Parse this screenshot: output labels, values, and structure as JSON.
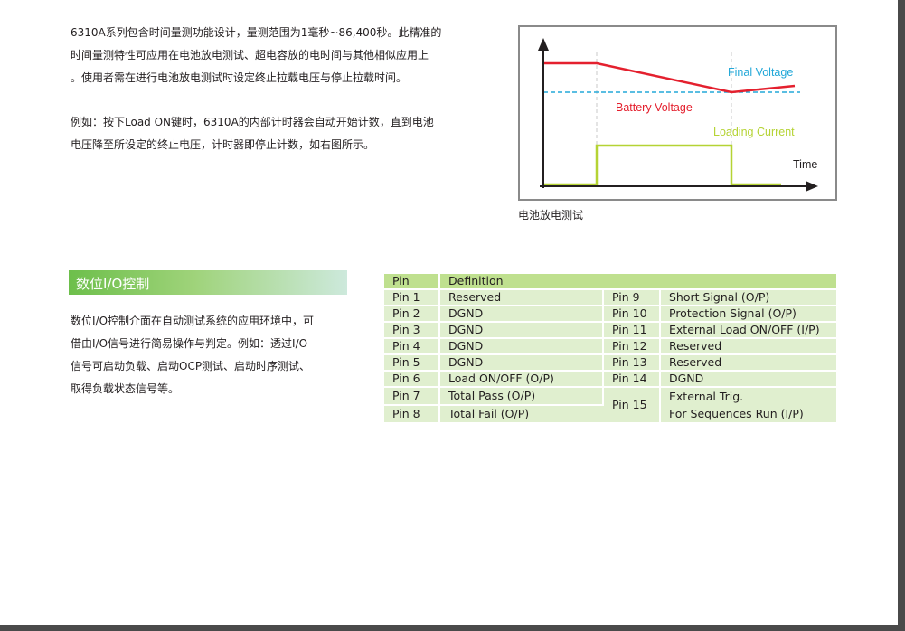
{
  "intro": {
    "lines": [
      "6310A系列包含时间量测功能设计，量测范围为1毫秒~86,400秒。此精准的",
      "时间量测特性可应用在电池放电测试、超电容放的电时间与其他相似应用上",
      "。使用者需在进行电池放电测试时设定终止拉载电压与停止拉载时间。"
    ]
  },
  "example": {
    "lines": [
      "例如：按下Load ON键时，6310A的内部计时器会自动开始计数，直到电池",
      "电压降至所设定的终止电压，计时器即停止计数，如右图所示。"
    ]
  },
  "figure": {
    "caption": "电池放电测试",
    "labels": {
      "final_voltage": "Final Voltage",
      "battery_voltage": "Battery Voltage",
      "loading_current": "Loading Current",
      "time": "Time"
    },
    "colors": {
      "battery": "#e4202e",
      "final_voltage": "#23a8d8",
      "current": "#b5d334",
      "axis": "#231f20",
      "guide": "#c8c8c8"
    }
  },
  "chart_data": {
    "type": "line",
    "title": "",
    "xlabel": "Time",
    "ylabel": "",
    "series": [
      {
        "name": "Battery Voltage",
        "points": [
          [
            0,
            7.2
          ],
          [
            1,
            7.2
          ],
          [
            3.4,
            5.9
          ],
          [
            4,
            6.3
          ]
        ]
      },
      {
        "name": "Final Voltage",
        "points": [
          [
            0,
            5.9
          ],
          [
            4,
            5.9
          ]
        ]
      },
      {
        "name": "Loading Current",
        "points": [
          [
            0,
            0
          ],
          [
            1,
            0
          ],
          [
            1,
            2.5
          ],
          [
            3.4,
            2.5
          ],
          [
            3.4,
            0
          ],
          [
            4,
            0
          ]
        ]
      }
    ]
  },
  "section": {
    "title": "数位I/O控制",
    "lines": [
      "数位I/O控制介面在自动测试系统的应用环境中，可",
      "借由I/O信号进行简易操作与判定。例如：透过I/O",
      "信号可启动负载、启动OCP测试、启动时序测试、",
      "取得负载状态信号等。"
    ]
  },
  "pin_table": {
    "headers": {
      "pin": "Pin",
      "definition": "Definition"
    },
    "rows": [
      {
        "l_pin": "Pin 1",
        "l_def": "Reserved",
        "r_pin": "Pin 9",
        "r_def": "Short Signal (O/P)"
      },
      {
        "l_pin": "Pin 2",
        "l_def": "DGND",
        "r_pin": "Pin 10",
        "r_def": "Protection Signal (O/P)"
      },
      {
        "l_pin": "Pin 3",
        "l_def": "DGND",
        "r_pin": "Pin 11",
        "r_def": "External Load ON/OFF (I/P)"
      },
      {
        "l_pin": "Pin 4",
        "l_def": "DGND",
        "r_pin": "Pin 12",
        "r_def": "Reserved"
      },
      {
        "l_pin": "Pin 5",
        "l_def": "DGND",
        "r_pin": "Pin 13",
        "r_def": "Reserved"
      },
      {
        "l_pin": "Pin 6",
        "l_def": "Load ON/OFF (O/P)",
        "r_pin": "Pin 14",
        "r_def": "DGND"
      },
      {
        "l_pin": "Pin 7",
        "l_def": "Total Pass (O/P)",
        "r_pin": "Pin 15",
        "r_def_1": "External Trig.",
        "r_def_2": "For Sequences Run (I/P)"
      },
      {
        "l_pin": "Pin 8",
        "l_def": "Total Fail (O/P)"
      }
    ]
  }
}
